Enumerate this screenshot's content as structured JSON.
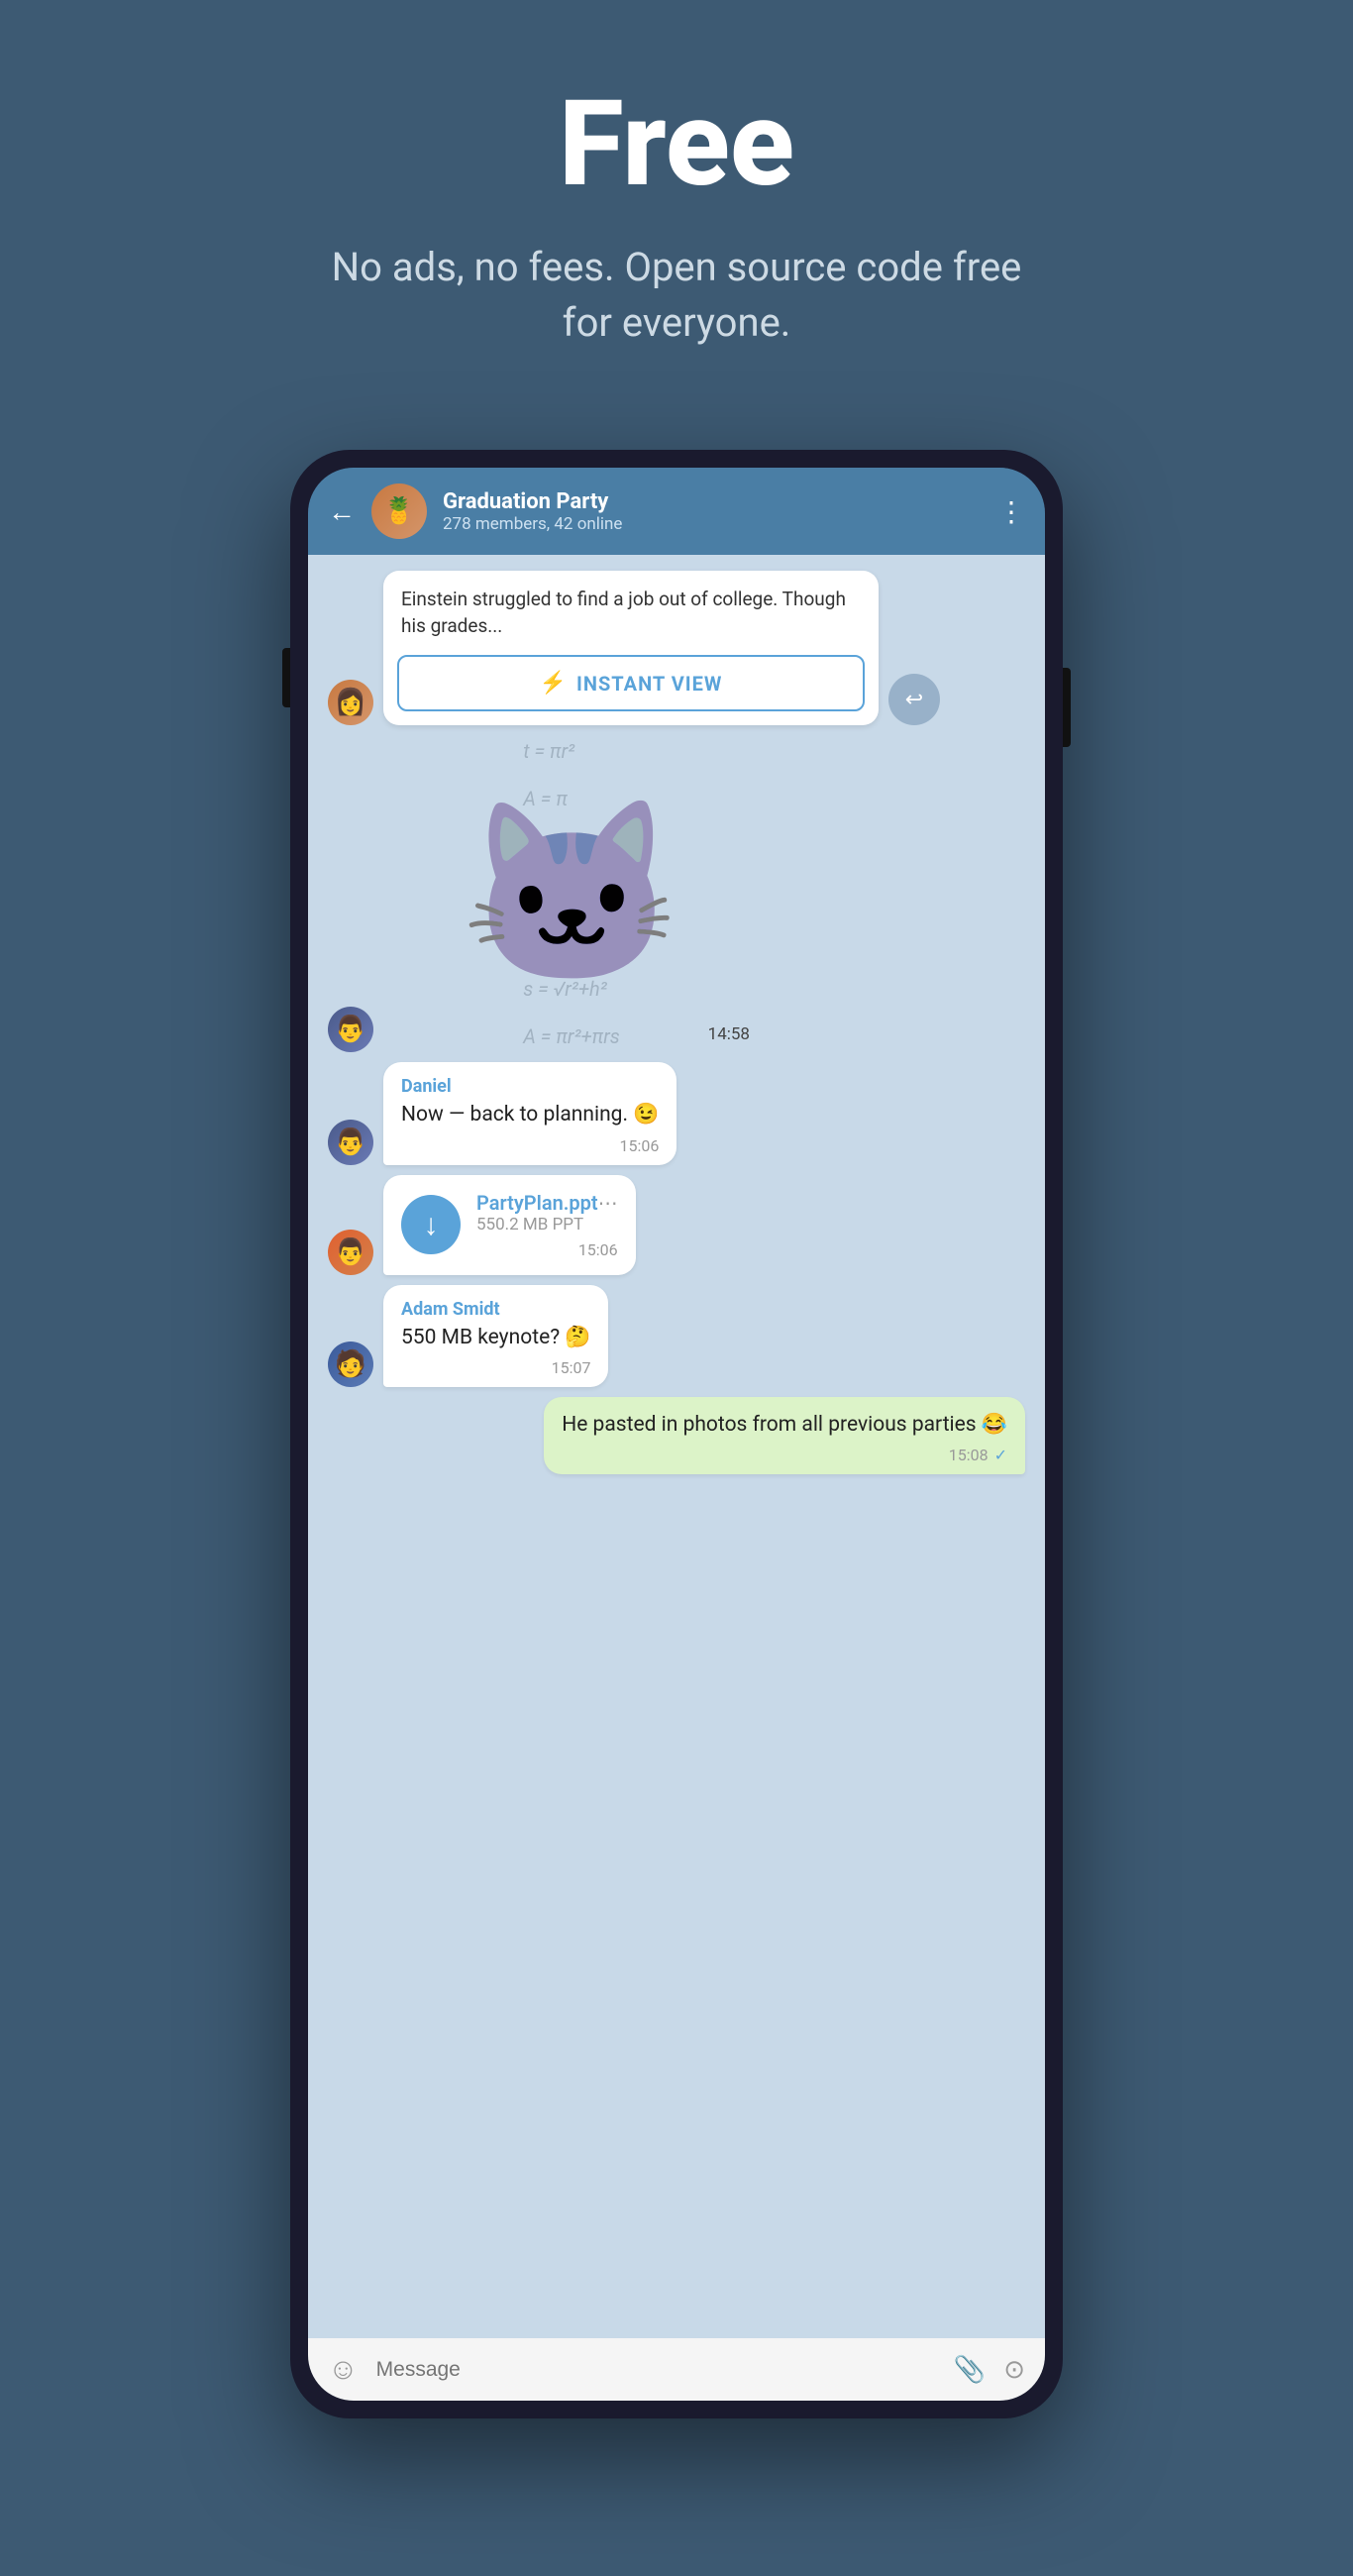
{
  "hero": {
    "title": "Free",
    "subtitle": "No ads, no fees. Open source code free for everyone."
  },
  "chat": {
    "back_label": "←",
    "group_name": "Graduation Party",
    "group_members": "278 members, 42 online",
    "group_avatar_emoji": "🍍",
    "more_icon": "⋮",
    "messages": [
      {
        "type": "link",
        "text": "Einstein struggled to find a job out of college. Though his grades...",
        "instant_view_label": "INSTANT VIEW",
        "time": ""
      },
      {
        "type": "sticker",
        "time": "14:58"
      },
      {
        "type": "text",
        "sender": "Daniel",
        "text": "Now — back to planning. 😉",
        "time": "15:06"
      },
      {
        "type": "file",
        "sender": "",
        "filename": "PartyPlan.ppt",
        "size": "550.2 MB PPT",
        "time": "15:06"
      },
      {
        "type": "text",
        "sender": "Adam Smidt",
        "text": "550 MB keynote? 🤔",
        "time": "15:07"
      },
      {
        "type": "text_self",
        "text": "He pasted in photos from all previous parties 😂",
        "time": "15:08",
        "read": true
      }
    ],
    "input": {
      "placeholder": "Message",
      "emoji_icon": "☺",
      "attach_icon": "📎",
      "camera_icon": "⊙"
    }
  }
}
